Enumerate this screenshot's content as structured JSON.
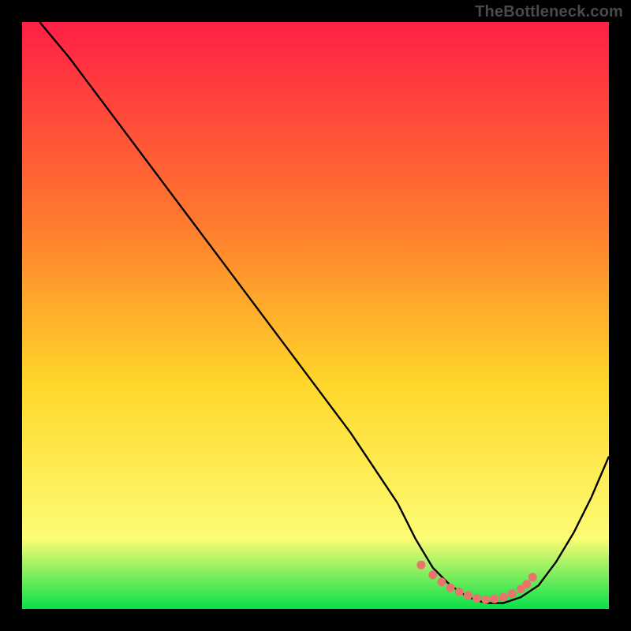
{
  "watermark": "TheBottleneck.com",
  "colors": {
    "black": "#000000",
    "curve": "#000000",
    "dot": "#e9746b",
    "grad_top": "#ff1f45",
    "grad_mid1": "#ff7a2e",
    "grad_mid2": "#ffd82a",
    "grad_mid3": "#fdfc74",
    "grad_bot": "#08e04a"
  },
  "chart_data": {
    "type": "line",
    "title": "",
    "xlabel": "",
    "ylabel": "",
    "xlim": [
      0,
      100
    ],
    "ylim": [
      0,
      100
    ],
    "series": [
      {
        "name": "bottleneck-curve",
        "x": [
          3,
          8,
          14,
          20,
          26,
          32,
          38,
          44,
          50,
          56,
          60,
          64,
          67,
          70,
          73,
          76,
          79,
          82,
          85,
          88,
          91,
          94,
          97,
          100
        ],
        "y": [
          100,
          94,
          86,
          78,
          70,
          62,
          54,
          46,
          38,
          30,
          24,
          18,
          12,
          7,
          4,
          2,
          1,
          1,
          2,
          4,
          8,
          13,
          19,
          26
        ]
      }
    ],
    "dots": {
      "name": "highlight-dots",
      "x": [
        68,
        70,
        71.5,
        73,
        74.5,
        76,
        77.5,
        79,
        80.5,
        82,
        83.5,
        85,
        86,
        87
      ],
      "y": [
        7.5,
        5.8,
        4.6,
        3.6,
        2.9,
        2.3,
        1.8,
        1.6,
        1.7,
        2.0,
        2.6,
        3.4,
        4.2,
        5.4
      ]
    }
  }
}
